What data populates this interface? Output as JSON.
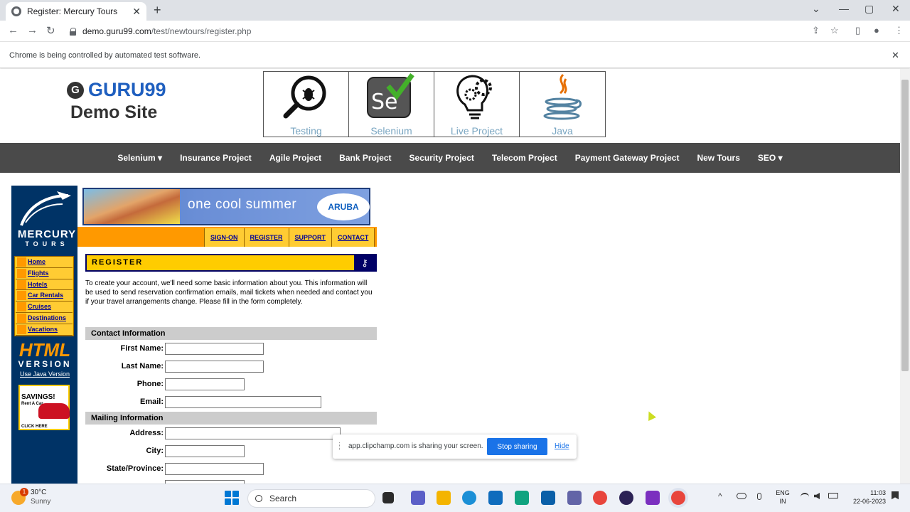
{
  "browser": {
    "tab_title": "Register: Mercury Tours",
    "tab_close": "✕",
    "new_tab": "+",
    "url_host": "demo.guru99.com",
    "url_path": "/test/newtours/register.php",
    "infobar_text": "Chrome is being controlled by automated test software.",
    "infobar_close": "✕",
    "back": "←",
    "forward": "→",
    "reload": "↻",
    "minimize": "—",
    "maximize": "▢",
    "close": "✕",
    "chevron": "⌄",
    "share_icon": "⇪",
    "star_icon": "☆",
    "sidepanel_icon": "▯",
    "profile_icon": "●",
    "menu_icon": "⋮"
  },
  "guru": {
    "logo_text": "GURU99",
    "logo_mark": "G",
    "subtitle": "Demo Site",
    "courses": [
      "Testing",
      "Selenium",
      "Live Project",
      "Java"
    ],
    "nav": [
      "Selenium ▾",
      "Insurance Project",
      "Agile Project",
      "Bank Project",
      "Security Project",
      "Telecom Project",
      "Payment Gateway Project",
      "New Tours",
      "SEO ▾"
    ]
  },
  "mercury": {
    "brand": "MERCURY",
    "brand_sub": "TOURS",
    "menu": [
      "Home",
      "Flights",
      "Hotels",
      "Car Rentals",
      "Cruises",
      "Destinations",
      "Vacations"
    ],
    "html_version_1": "HTML",
    "html_version_2": "VERSION",
    "java_link": "Use Java Version",
    "savings": "SAVINGS!",
    "rent": "Rent A Car",
    "click_here": "CLICK HERE",
    "banner_text": "one cool summer",
    "banner_brand": "ARUBA",
    "top_links": [
      "SIGN-ON",
      "REGISTER",
      "SUPPORT",
      "CONTACT"
    ],
    "register_title": "REGISTER",
    "key_icon": "⚷",
    "intro": "To create your account, we'll need some basic information about you. This information will be used to send reservation confirmation emails, mail tickets when needed and contact you if your travel arrangements change. Please fill in the form completely.",
    "contact_section": "Contact Information",
    "mailing_section": "Mailing Information",
    "fields": {
      "first_name": {
        "label": "First Name:",
        "value": ""
      },
      "last_name": {
        "label": "Last Name:",
        "value": ""
      },
      "phone": {
        "label": "Phone:",
        "value": ""
      },
      "email": {
        "label": "Email:",
        "value": ""
      },
      "address": {
        "label": "Address:",
        "value": ""
      },
      "city": {
        "label": "City:",
        "value": ""
      },
      "state": {
        "label": "State/Province:",
        "value": ""
      }
    }
  },
  "share_bar": {
    "text": "app.clipchamp.com is sharing your screen.",
    "stop": "Stop sharing",
    "hide": "Hide"
  },
  "taskbar": {
    "weather_temp": "30°C",
    "weather_cond": "Sunny",
    "weather_badge": "1",
    "search": "Search",
    "lang_1": "ENG",
    "lang_2": "IN",
    "time": "11:03",
    "date": "22-06-2023",
    "tray_up": "^"
  },
  "colors": {
    "chrome_tabstrip": "#dee1e6",
    "guru_nav": "#4a4a4a",
    "mercury_navy": "#003366",
    "mercury_yellow": "#ffcc00",
    "mercury_orange": "#ff9900",
    "stop_sharing_blue": "#1a73e8"
  }
}
